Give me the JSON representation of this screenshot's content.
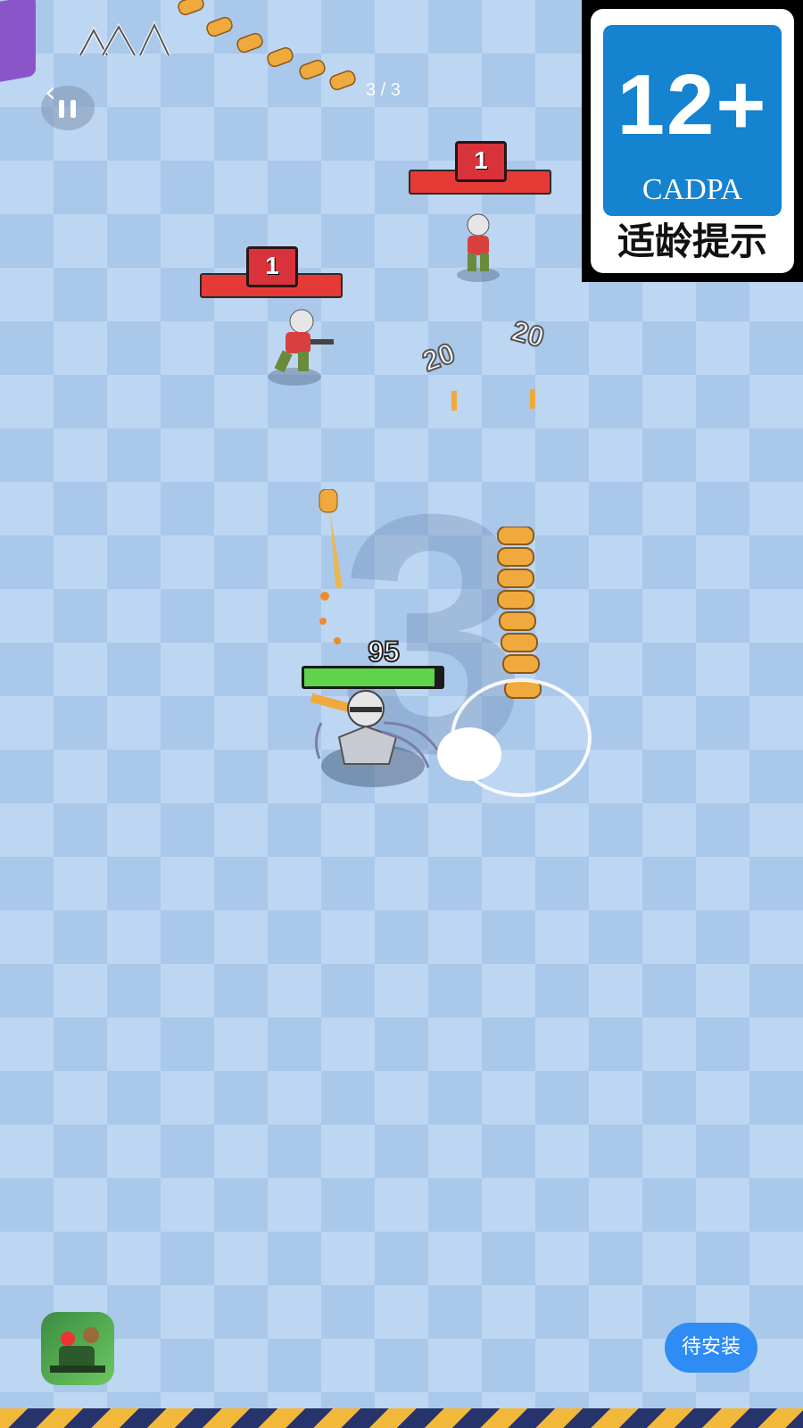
{
  "hud": {
    "page_indicator": "3 / 3",
    "back_icon": "chevron-left-icon",
    "pause_icon": "pause-icon",
    "crown_icon": "crown-icon"
  },
  "age_rating": {
    "rating": "12+",
    "org": "CADPA",
    "caption": "适龄提示",
    "color": "#1583cf"
  },
  "enemies": [
    {
      "level": "1"
    },
    {
      "level": "1"
    }
  ],
  "damage_numbers": [
    "20",
    "20"
  ],
  "player": {
    "health": "95",
    "health_fraction": 0.95
  },
  "wave_number": "3",
  "install_button": {
    "label": "待安装"
  },
  "colors": {
    "enemy_hp": "#e53a35",
    "player_hp": "#5fd34a",
    "install_button": "#2f8cf4"
  }
}
